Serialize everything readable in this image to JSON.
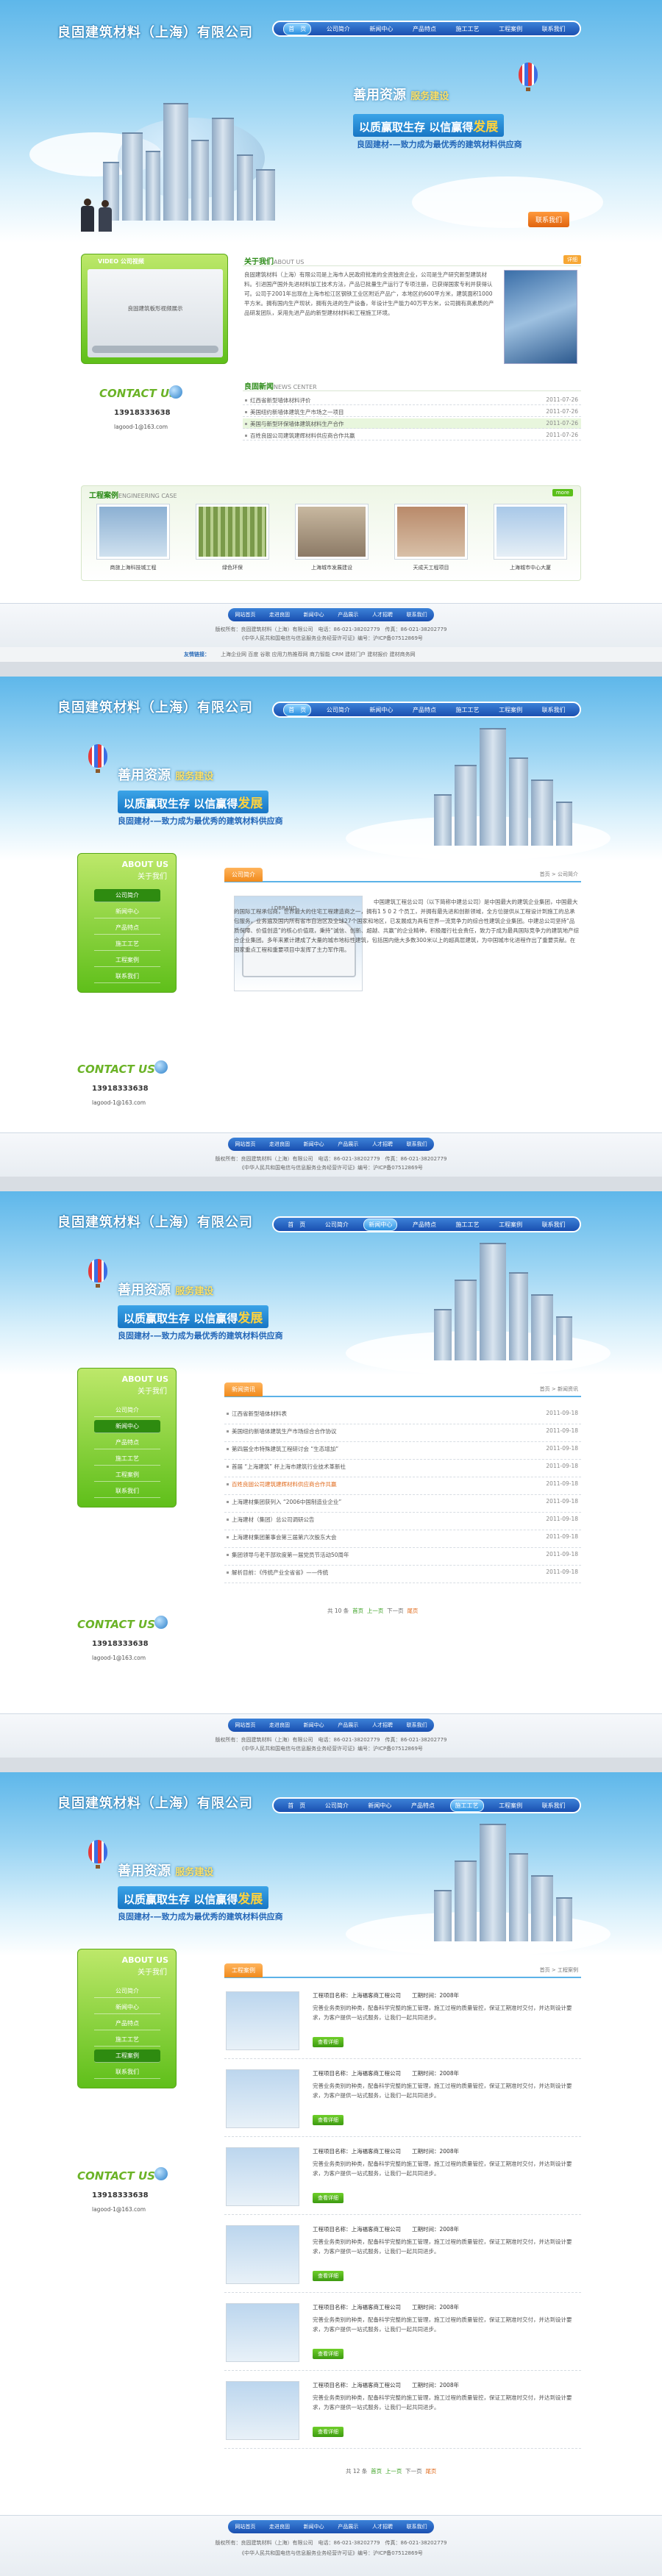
{
  "site": {
    "logo": "良固建筑材料（上海）有限公司",
    "nav": [
      "首　页",
      "公司简介",
      "新闻中心",
      "产品特点",
      "施工工艺",
      "工程案例",
      "联系我们"
    ],
    "slogan_a": "善用资源",
    "slogan_b": "服务建设",
    "slogan_c": "以质赢取生存",
    "slogan_d": "以信赢得",
    "slogan_e": "发展",
    "slogan_sub": "良固建材-—致力成为最优秀的建筑材料供应商",
    "contact_btn": "联系我们"
  },
  "footer": {
    "links": [
      "网站首页",
      "走进良固",
      "新闻中心",
      "产品展示",
      "人才招聘",
      "联系我们"
    ],
    "line1": "版权所有：良固建筑材料（上海）有限公司　电话：86-021-38202779　传真：86-021-38202779",
    "line2": "《中华人民共和国电信与信息服务业务经营许可证》编号：沪ICP备07512869号",
    "links_label": "友情链接：",
    "friend_links": "上海企业网  百度  谷歌  应用力热推荐网  商力智能  CRM  建材门户  建材报价  建材商务网"
  },
  "home": {
    "video_title": "VIDEO  公司视频",
    "video_caption": "良固建筑板形视频展示",
    "about_title": "关于我们",
    "about_en": "ABOUT US",
    "about_more": "详细",
    "about_text": "良固建筑材料（上海）有限公司是上海市人民政府批准的全资独资企业，公司是生产研究新型建筑材料。引进国产国外先进材料加工技术方法，产品已批量生产运行了专项注册，已获得国家专利并获得认可。公司于2001年出现在上海市松江区钢铁工业区附近产品广，本地区约600平方米，建筑面积1000平方米。拥有国内生产现状，拥有先进的生产设备，年设计生产能力40万平方米，公司拥有高素质的产品研发团队，采用先进产品的新型建材材料和工程施工环境。",
    "news_title": "良固新闻",
    "news_en": "NEWS CENTER",
    "news_more": "更多",
    "news": [
      {
        "t": "红西省新型墙体材料评价",
        "d": "2011-07-26"
      },
      {
        "t": "美国纽约新墙体建筑生产市场之一项目",
        "d": "2011-07-26"
      },
      {
        "t": "美国与新型环保墙体建筑材料生产合作",
        "d": "2011-07-26"
      },
      {
        "t": "百姓良固公司建筑建辉材料供应商合作共赢",
        "d": "2011-07-26"
      }
    ],
    "contact_title": "CONTACT US",
    "phone": "13918333638",
    "email": "lagood-1@163.com",
    "case_title": "工程案例",
    "case_en": "ENGINEERING CASE",
    "case_more": "more",
    "cases": [
      "商旅上海科技城工程",
      "绿色环保",
      "上海城市发展建设",
      "天成天工程项目",
      "上海城市中心大厦"
    ]
  },
  "inner": {
    "about_title": "ABOUT US",
    "about_cn": "关于我们",
    "menu": [
      "公司简介",
      "新闻中心",
      "产品特点",
      "施工工艺",
      "工程案例",
      "联系我们"
    ],
    "contact_title": "CONTACT US",
    "phone": "13918333638",
    "email": "lagood-1@163.com"
  },
  "about_page": {
    "tab": "公司简介",
    "crumb": "首页 > 公司简介",
    "photo_label": "LDBRAND",
    "text": "中国建筑工程总公司（以下简称中建总公司）是中国最大的建筑企业集团，中国最大的国际工程承包商，世界最大的住宅工程建造商之一，拥有1 5 0 2 个员工，并拥有最先进和创新领域，全方位提供从工程设计到施工的总承包服务，业务遍及国内所有省市自治区及全球27个国家和地区，已发展成为具有世界一流竞争力的综合性建筑企业集团。中建总公司坚持“品质保障、价值创造”的核心价值观，秉持“诚信、创新、超越、共赢”的企业精神，积极履行社会责任，致力于成为最具国际竞争力的建筑地产综合企业集团。多年来累计建成了大量的城市地标性建筑，包括国内绝大多数300米以上的超高层建筑，为中国城市化进程作出了重要贡献。在国家重点工程和重要项目中发挥了主力军作用。"
  },
  "news_page": {
    "tab": "新闻资讯",
    "crumb": "首页 > 新闻资讯",
    "items": [
      {
        "t": "江西省新型墙体材料表",
        "d": "2011-09-18"
      },
      {
        "t": "美国纽约新墙体建筑生产市场综合合作协议",
        "d": "2011-09-18"
      },
      {
        "t": "第四届全市特殊建筑工程研讨会 “生态增加”",
        "d": "2011-09-18"
      },
      {
        "t": "首届 “上海建筑” 杯上海市建筑行业技术革新社",
        "d": "2011-09-18"
      },
      {
        "t": "百姓良固公司建筑建辉材料供应商合作共赢",
        "d": "2011-09-18"
      },
      {
        "t": "上海建材集团获列入 “2006中国制造业企业”",
        "d": "2011-09-18"
      },
      {
        "t": "上海建材（集团）总公司调研公告",
        "d": "2011-09-18"
      },
      {
        "t": "上海建材集团董事会第三届第六次股东大会",
        "d": "2011-09-18"
      },
      {
        "t": "集团领导与老干部欢度第一届党员节活动50周年",
        "d": "2011-09-18"
      },
      {
        "t": "解析目前：《传统产业全省省》——传统",
        "d": "2011-09-18"
      }
    ],
    "pager": [
      "共 10 条",
      "首页",
      "上一页",
      "下一页",
      "尾页"
    ]
  },
  "case_page": {
    "tab": "工程案例",
    "crumb": "首页 > 工程案例",
    "items": [
      {
        "name": "工程项目名称：上海福客商工程公司",
        "time": "工期时间：2008年",
        "desc": "完善业务类别的种类，配备科学完整的施工管理，施工过程的质量管控，保证工期准时交付，并达到设计要求，为客户提供一站式服务，让我们一起共同进步。",
        "btn": "查看详细"
      },
      {
        "name": "工程项目名称：上海福客商工程公司",
        "time": "工期时间：2008年",
        "desc": "完善业务类别的种类，配备科学完整的施工管理，施工过程的质量管控，保证工期准时交付，并达到设计要求，为客户提供一站式服务，让我们一起共同进步。",
        "btn": "查看详细"
      },
      {
        "name": "工程项目名称：上海福客商工程公司",
        "time": "工期时间：2008年",
        "desc": "完善业务类别的种类，配备科学完整的施工管理，施工过程的质量管控，保证工期准时交付，并达到设计要求，为客户提供一站式服务，让我们一起共同进步。",
        "btn": "查看详细"
      },
      {
        "name": "工程项目名称：上海福客商工程公司",
        "time": "工期时间：2008年",
        "desc": "完善业务类别的种类，配备科学完整的施工管理，施工过程的质量管控，保证工期准时交付，并达到设计要求，为客户提供一站式服务，让我们一起共同进步。",
        "btn": "查看详细"
      },
      {
        "name": "工程项目名称：上海福客商工程公司",
        "time": "工期时间：2008年",
        "desc": "完善业务类别的种类，配备科学完整的施工管理，施工过程的质量管控，保证工期准时交付，并达到设计要求，为客户提供一站式服务，让我们一起共同进步。",
        "btn": "查看详细"
      },
      {
        "name": "工程项目名称：上海福客商工程公司",
        "time": "工期时间：2008年",
        "desc": "完善业务类别的种类，配备科学完整的施工管理，施工过程的质量管控，保证工期准时交付，并达到设计要求，为客户提供一站式服务，让我们一起共同进步。",
        "btn": "查看详细"
      }
    ],
    "pager": [
      "共 12 条",
      "首页",
      "上一页",
      "下一页",
      "尾页"
    ]
  }
}
